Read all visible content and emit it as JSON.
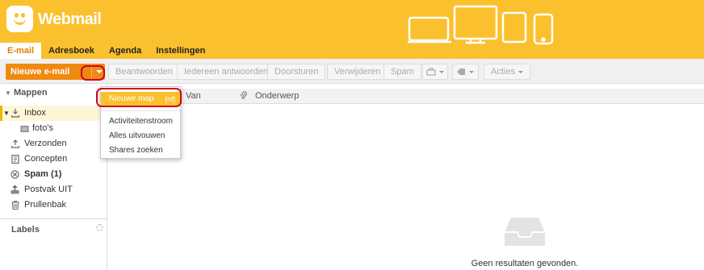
{
  "brand": {
    "name": "Webmail",
    "color": "#fbc02d",
    "accent": "#ef8a11"
  },
  "tabs": [
    {
      "label": "E-mail",
      "active": true
    },
    {
      "label": "Adresboek",
      "active": false
    },
    {
      "label": "Agenda",
      "active": false
    },
    {
      "label": "Instellingen",
      "active": false
    }
  ],
  "toolbar": {
    "new_mail": "Nieuwe e-mail",
    "reply": "Beantwoorden",
    "reply_all": "Iedereen antwoorden",
    "forward": "Doorsturen",
    "delete": "Verwijderen",
    "spam": "Spam",
    "actions": "Acties"
  },
  "sidebar": {
    "folders_heading": "Mappen",
    "folders": [
      {
        "label": "Inbox",
        "icon": "inbox-icon",
        "selected": true
      },
      {
        "label": "foto's",
        "icon": "folder-icon",
        "selected": false
      },
      {
        "label": "Verzonden",
        "icon": "sent-icon",
        "selected": false
      },
      {
        "label": "Concepten",
        "icon": "drafts-icon",
        "selected": false
      },
      {
        "label": "Spam (1)",
        "icon": "spam-icon",
        "selected": false
      },
      {
        "label": "Postvak UIT",
        "icon": "outbox-icon",
        "selected": false
      },
      {
        "label": "Prullenbak",
        "icon": "trash-icon",
        "selected": false
      }
    ],
    "labels_heading": "Labels"
  },
  "list": {
    "columns": {
      "from": "Van",
      "subject": "Onderwerp"
    },
    "empty_text": "Geen resultaten gevonden."
  },
  "dropdown": {
    "items": [
      {
        "label": "Nieuwe map",
        "shortcut": "[nf]",
        "active": true
      },
      {
        "label": "Activiteitenstroom"
      },
      {
        "label": "Alles uitvouwen"
      },
      {
        "label": "Shares zoeken"
      }
    ]
  }
}
